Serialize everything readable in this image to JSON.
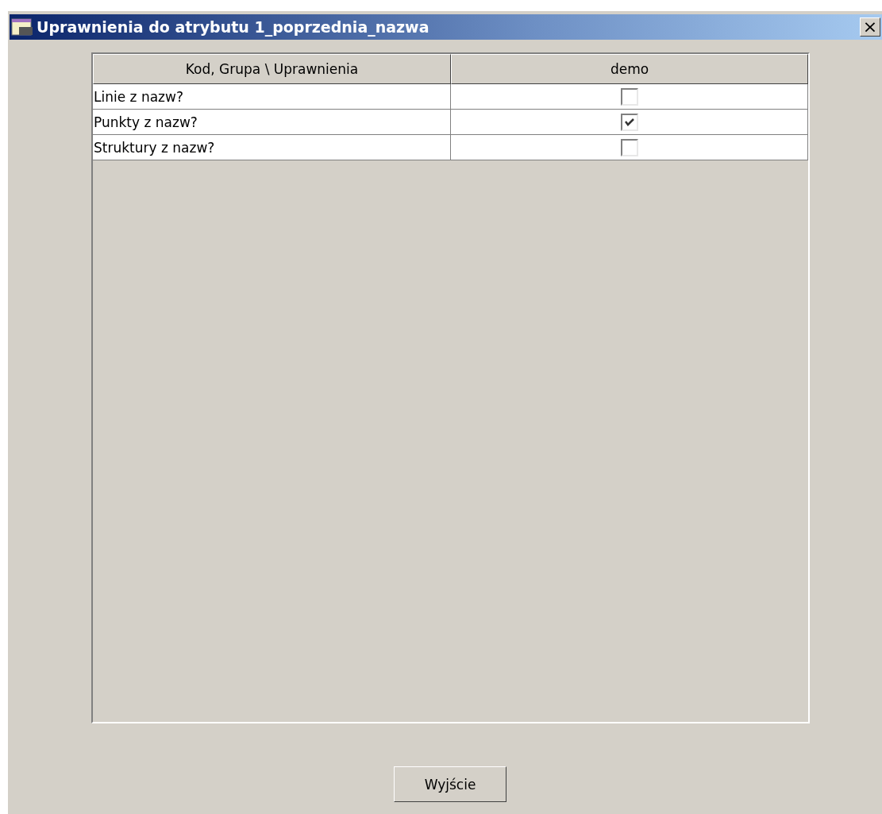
{
  "window": {
    "title": "Uprawnienia do atrybutu 1_poprzednia_nazwa",
    "close_button": "×"
  },
  "table": {
    "columns": [
      "Kod, Grupa \\ Uprawnienia",
      "demo"
    ],
    "rows": [
      {
        "name": "Linie z nazw?",
        "checked": false
      },
      {
        "name": "Punkty z nazw?",
        "checked": true
      },
      {
        "name": "Struktury z nazw?",
        "checked": false
      }
    ]
  },
  "buttons": [
    "Wyjście"
  ]
}
